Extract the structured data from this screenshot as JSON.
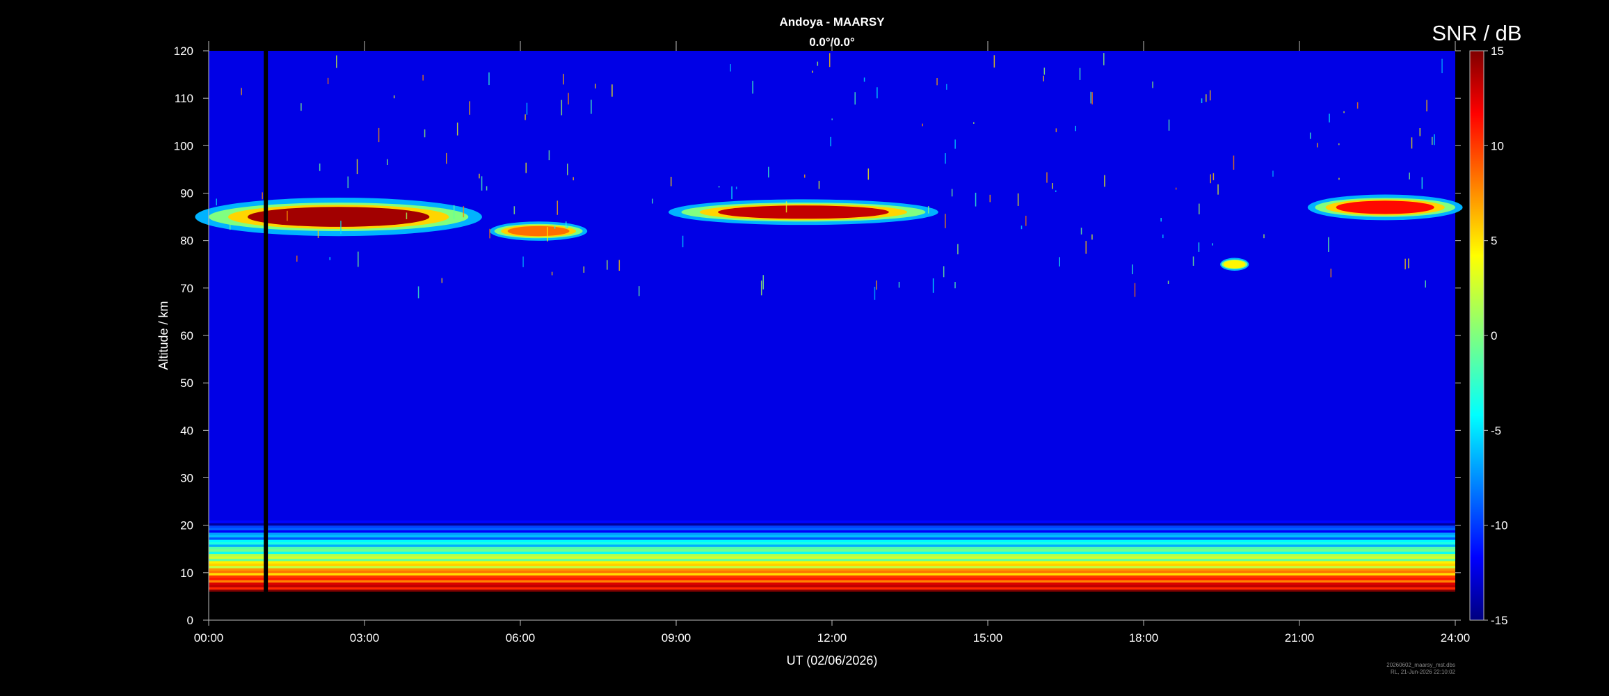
{
  "chart_data": {
    "type": "heatmap",
    "title": "Andoya - MAARSY",
    "subtitle": "0.0°/0.0°",
    "xlabel": "UT (02/06/2026)",
    "ylabel": "Altitude / km",
    "xlim": [
      0,
      24
    ],
    "ylim": [
      0,
      120
    ],
    "x_ticks": [
      "00:00",
      "03:00",
      "06:00",
      "09:00",
      "12:00",
      "15:00",
      "18:00",
      "21:00",
      "24:00"
    ],
    "y_ticks": [
      0,
      10,
      20,
      30,
      40,
      50,
      60,
      70,
      80,
      90,
      100,
      110,
      120
    ],
    "colorbar": {
      "label": "SNR / dB",
      "range": [
        -15,
        15
      ],
      "ticks": [
        15,
        10,
        5,
        0,
        -5,
        -10,
        -15
      ],
      "colormap": "jet"
    },
    "data_gap": {
      "x": 1.1,
      "from_alt": 6,
      "to_alt": 120
    },
    "no_data_below_alt": 6,
    "features": [
      {
        "description": "PMSE layer",
        "x_start": 0.0,
        "x_end": 5.0,
        "alt_center": 85,
        "thickness": 6,
        "snr": 14
      },
      {
        "description": "PMSE layer",
        "x_start": 5.5,
        "x_end": 7.2,
        "alt_center": 82,
        "thickness": 3,
        "snr": 8
      },
      {
        "description": "PMSE layer",
        "x_start": 9.1,
        "x_end": 13.8,
        "alt_center": 86,
        "thickness": 4,
        "snr": 13
      },
      {
        "description": "PMSE layer",
        "x_start": 21.3,
        "x_end": 24.0,
        "alt_center": 87,
        "thickness": 4,
        "snr": 11
      },
      {
        "description": "PMSE patch",
        "x_start": 19.5,
        "x_end": 20.0,
        "alt_center": 75,
        "thickness": 2,
        "snr": 4
      },
      {
        "description": "Tropospheric echoes",
        "x_start": 0.0,
        "x_end": 24.0,
        "alt_from": 6,
        "alt_to": 21,
        "snr_max": 15
      }
    ],
    "background_snr": -12
  },
  "footer": {
    "line1": "20260602_maarsy_mst.dbs",
    "line2": "RL, 21-Jun-2026 22:10:02"
  }
}
